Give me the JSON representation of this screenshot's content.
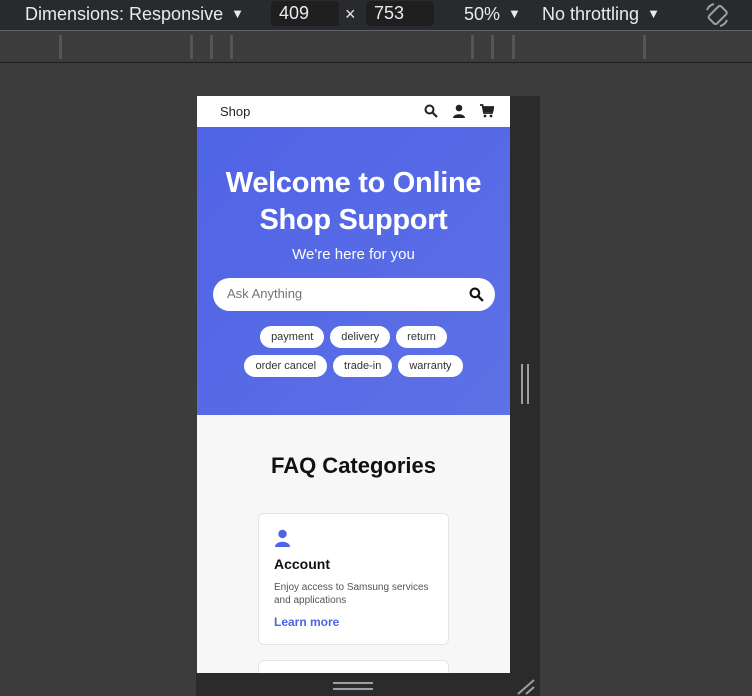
{
  "devtools": {
    "dimensions_label": "Dimensions: Responsive",
    "width": "409",
    "height": "753",
    "times": "×",
    "zoom": "50%",
    "throttling": "No throttling",
    "icons": [
      "caret-down-icon",
      "rotate-icon",
      "resize-handle-icon"
    ]
  },
  "page": {
    "nav": {
      "brand": "Shop",
      "icons": [
        "search-icon",
        "user-icon",
        "cart-icon"
      ]
    },
    "hero": {
      "title": "Welcome to Online Shop Support",
      "subtitle": "We're here for you",
      "search_placeholder": "Ask Anything",
      "chips_row1": [
        "payment",
        "delivery",
        "return"
      ],
      "chips_row2": [
        "order cancel",
        "trade-in",
        "warranty"
      ]
    },
    "faq": {
      "title": "FAQ Categories",
      "cards": [
        {
          "title": "Account",
          "description": "Enjoy access to Samsung services and applications",
          "link": "Learn more"
        }
      ]
    }
  },
  "colors": {
    "accent": "#4f63e6",
    "devtools_bg": "#292a2d"
  }
}
